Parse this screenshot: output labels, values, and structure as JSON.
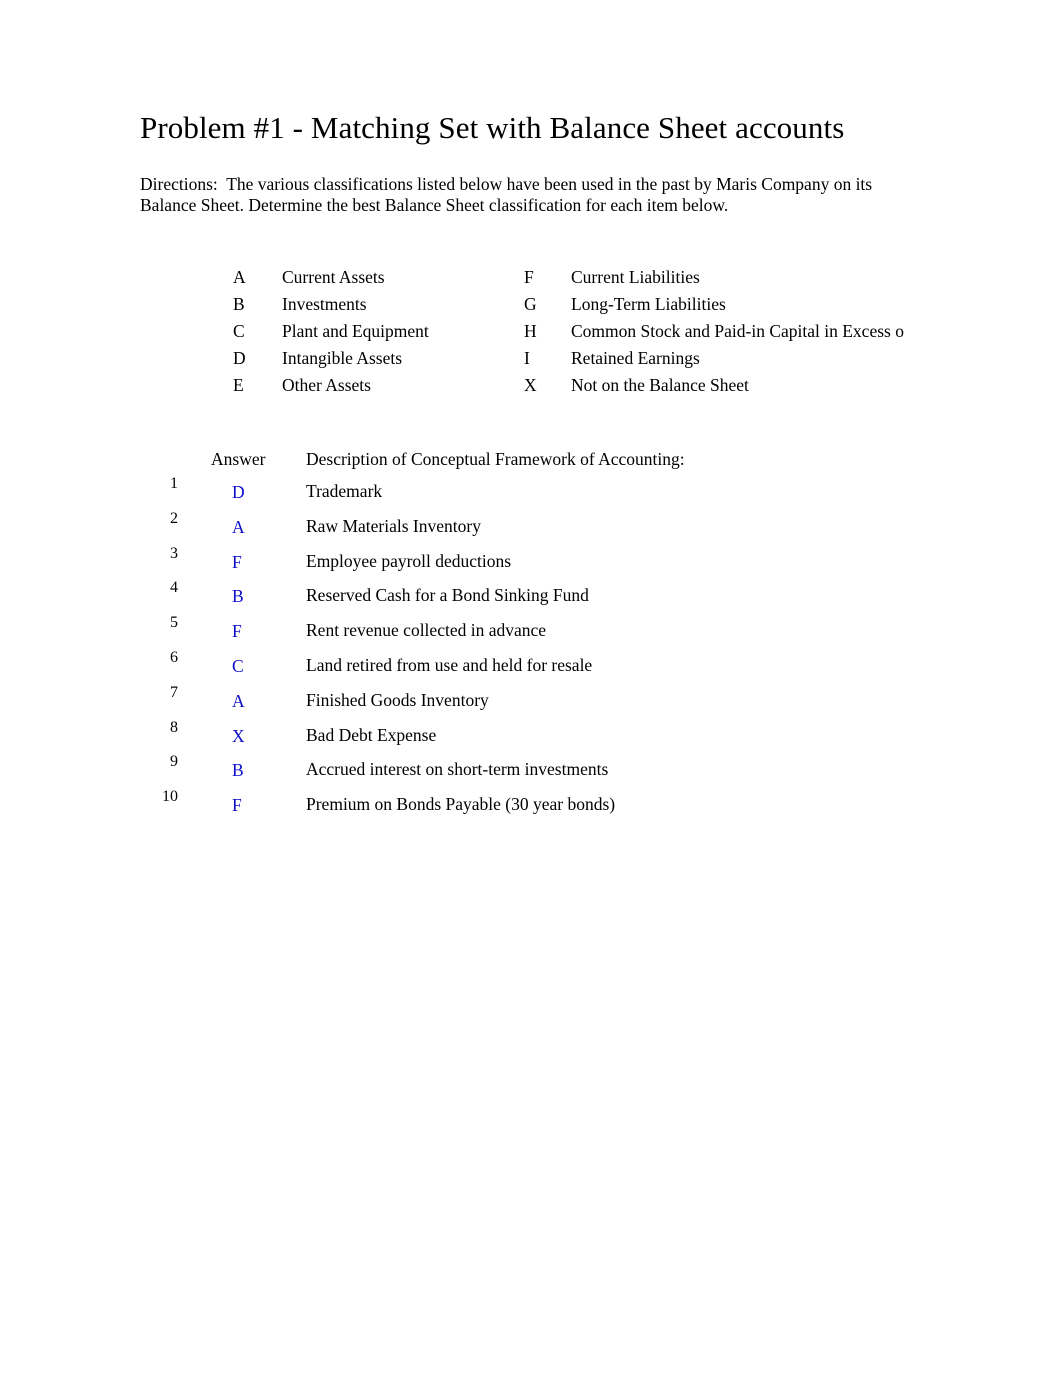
{
  "document": {
    "title": "Problem #1 - Matching Set with Balance Sheet accounts",
    "directions": "Directions:  The various classifications listed below have been used in the past by Maris Company on its Balance Sheet. Determine the best Balance Sheet classification for each item below."
  },
  "colors": {
    "page_background": "#ffffff",
    "body_text": "#000000",
    "answer_letter": "#0d0dc8"
  },
  "legend": {
    "rows": [
      {
        "left_letter": "A",
        "left_label": "Current Assets",
        "right_letter": "F",
        "right_label": "Current Liabilities"
      },
      {
        "left_letter": "B",
        "left_label": "Investments",
        "right_letter": "G",
        "right_label": "Long-Term Liabilities"
      },
      {
        "left_letter": "C",
        "left_label": "Plant and Equipment",
        "right_letter": "H",
        "right_label": "Common Stock and Paid-in Capital in Excess o"
      },
      {
        "left_letter": "D",
        "left_label": "Intangible Assets",
        "right_letter": "I",
        "right_label": "Retained Earnings"
      },
      {
        "left_letter": "E",
        "left_label": "Other Assets",
        "right_letter": "X",
        "right_label": "Not on the Balance Sheet"
      }
    ]
  },
  "answer_table": {
    "header": {
      "answer": "Answer",
      "description": "Description of Conceptual Framework of Accounting:"
    },
    "rows": [
      {
        "num": "1",
        "answer": "D",
        "description": "Trademark"
      },
      {
        "num": "2",
        "answer": "A",
        "description": "Raw Materials Inventory"
      },
      {
        "num": "3",
        "answer": "F",
        "description": "Employee payroll deductions"
      },
      {
        "num": "4",
        "answer": "B",
        "description": "Reserved Cash for a Bond Sinking Fund"
      },
      {
        "num": "5",
        "answer": "F",
        "description": "Rent revenue collected in advance"
      },
      {
        "num": "6",
        "answer": "C",
        "description": "Land retired from use and held for resale"
      },
      {
        "num": "7",
        "answer": "A",
        "description": "Finished Goods Inventory"
      },
      {
        "num": "8",
        "answer": "X",
        "description": "Bad Debt Expense"
      },
      {
        "num": "9",
        "answer": "B",
        "description": "Accrued interest on short-term investments"
      },
      {
        "num": "10",
        "answer": "F",
        "description": "Premium on Bonds Payable (30 year bonds)"
      }
    ]
  }
}
